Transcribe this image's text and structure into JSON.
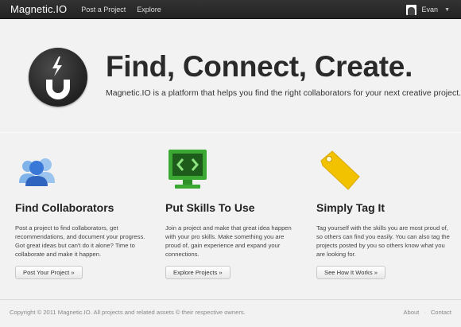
{
  "navbar": {
    "brand": "Magnetic.IO",
    "links": [
      "Post a Project",
      "Explore"
    ],
    "user": {
      "name": "Evan"
    }
  },
  "hero": {
    "title": "Find, Connect, Create.",
    "subtitle": "Magnetic.IO is a platform that helps you find the right collaborators for your next creative project."
  },
  "columns": [
    {
      "icon": "collaborators-icon",
      "title": "Find Collaborators",
      "text": "Post a project to find collaborators, get recommendations, and document your progress. Got great ideas but can't do it alone? Time to collaborate and make it happen.",
      "button": "Post Your Project »"
    },
    {
      "icon": "monitor-code-icon",
      "title": "Put Skills To Use",
      "text": "Join a project and make that great idea happen with your pro skills. Make something you are proud of, gain experience and expand your connections.",
      "button": "Explore Projects »"
    },
    {
      "icon": "tag-icon",
      "title": "Simply Tag It",
      "text": "Tag yourself with the skills you are most proud of, so others can find you easily. You can also tag the projects posted by you so others know what you are looking for.",
      "button": "See How It Works »"
    }
  ],
  "footer": {
    "copyright": "Copyright © 2011 Magnetic.IO. All projects and related assets © their respective owners.",
    "links": [
      "About",
      "Contact"
    ]
  },
  "colors": {
    "navbar": "#222222",
    "background": "#f2f2f2",
    "accent_green": "#3aa833",
    "accent_yellow": "#f2c200",
    "accent_blue": "#3a78d8"
  }
}
